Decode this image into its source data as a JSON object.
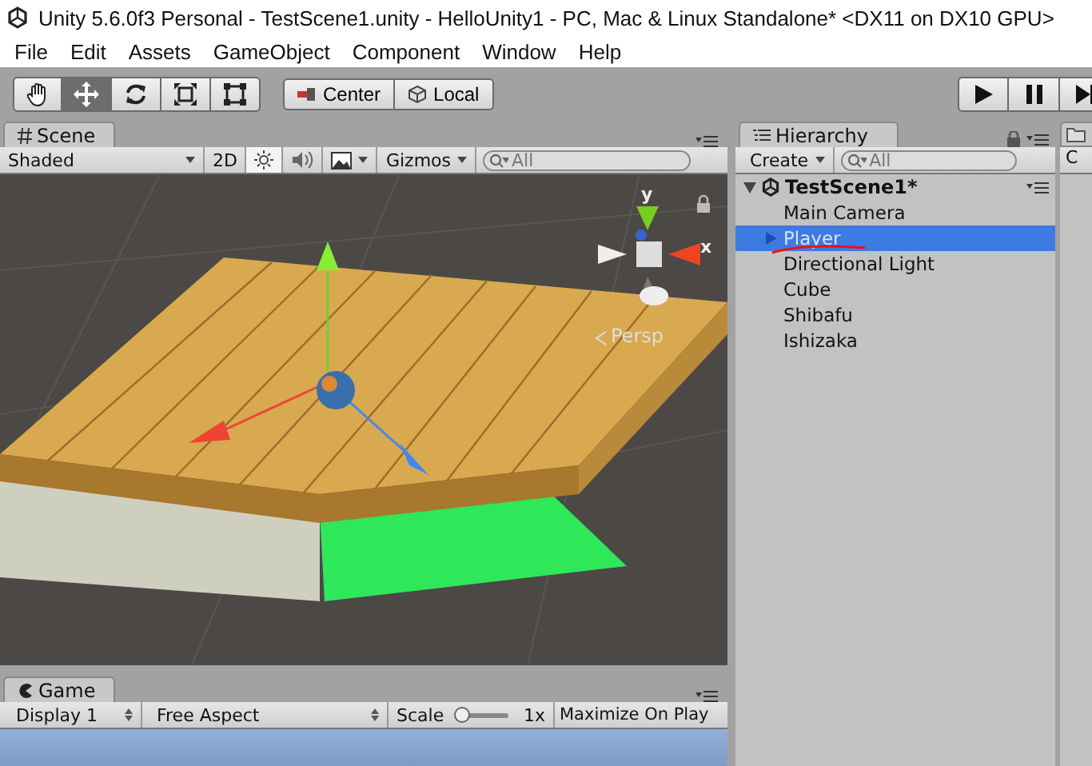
{
  "window": {
    "title": "Unity 5.6.0f3 Personal - TestScene1.unity - HelloUnity1 - PC, Mac & Linux Standalone* <DX11 on DX10 GPU>"
  },
  "menu": [
    "File",
    "Edit",
    "Assets",
    "GameObject",
    "Component",
    "Window",
    "Help"
  ],
  "tools": [
    {
      "kind": "hand",
      "selected": false
    },
    {
      "kind": "move",
      "selected": true
    },
    {
      "kind": "rotate",
      "selected": false
    },
    {
      "kind": "scale",
      "selected": false
    },
    {
      "kind": "rect",
      "selected": false
    }
  ],
  "pivot_buttons": [
    {
      "kind": "center",
      "label": "Center"
    },
    {
      "kind": "local",
      "label": "Local"
    }
  ],
  "play_buttons": [
    {
      "kind": "play"
    },
    {
      "kind": "pause"
    },
    {
      "kind": "step"
    }
  ],
  "scene": {
    "tab": "Scene",
    "shading": "Shaded",
    "mode_2d": "2D",
    "gizmos": "Gizmos",
    "search": {
      "placeholder": "All"
    },
    "axis_labels": [
      "y",
      "x"
    ],
    "projection": "Persp"
  },
  "hierarchy": {
    "tab": "Hierarchy",
    "create": "Create",
    "search": {
      "placeholder": "All"
    },
    "scene_name": "TestScene1*",
    "items": [
      {
        "label": "Main Camera",
        "selected": false,
        "collapsed": false,
        "annotated": false
      },
      {
        "label": "Player",
        "selected": true,
        "collapsed": true,
        "annotated": true
      },
      {
        "label": "Directional Light",
        "selected": false,
        "collapsed": false,
        "annotated": false
      },
      {
        "label": "Cube",
        "selected": false,
        "collapsed": false,
        "annotated": false
      },
      {
        "label": "Shibafu",
        "selected": false,
        "collapsed": false,
        "annotated": false
      },
      {
        "label": "Ishizaka",
        "selected": false,
        "collapsed": false,
        "annotated": false
      }
    ]
  },
  "right_panel": {
    "button": "C"
  },
  "game": {
    "tab": "Game",
    "display": "Display 1",
    "aspect": "Free Aspect",
    "scale_label": "Scale",
    "scale": {
      "level": 0.05
    },
    "scale_value": "1x",
    "maximize": "Maximize On Play"
  }
}
